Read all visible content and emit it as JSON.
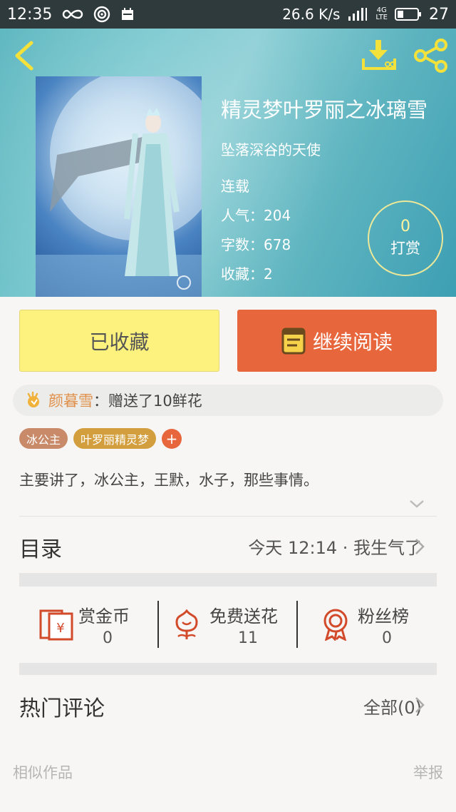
{
  "status_bar": {
    "time": "12:35",
    "speed": "26.6 K/s",
    "battery": "27"
  },
  "book": {
    "title": "精灵梦叶罗丽之冰璃雪",
    "author": "坠落深谷的天使",
    "status": "连载",
    "popularity_label": "人气：",
    "popularity": "204",
    "words_label": "字数：",
    "words": "678",
    "favorites_label": "收藏：",
    "favorites": "2"
  },
  "reward": {
    "count": "0",
    "label": "打赏"
  },
  "actions": {
    "favorited_label": "已收藏",
    "continue_label": "继续阅读"
  },
  "gift": {
    "user": "颜暮雪",
    "message": "：赠送了10鲜花"
  },
  "tags": [
    {
      "label": "冰公主",
      "color": "#c98a6a"
    },
    {
      "label": "叶罗丽精灵梦",
      "color": "#d39f3e"
    }
  ],
  "tag_add": "+",
  "description": "主要讲了，冰公主，王默，水子，那些事情。",
  "toc": {
    "title": "目录",
    "latest": "今天 12:14 · 我生气了"
  },
  "stats": [
    {
      "label": "赏金币",
      "value": "0",
      "icon": "red-envelope-icon"
    },
    {
      "label": "免费送花",
      "value": "11",
      "icon": "flower-icon"
    },
    {
      "label": "粉丝榜",
      "value": "0",
      "icon": "award-ribbon-icon"
    }
  ],
  "comments": {
    "title": "热门评论",
    "all_label": "全部(0)"
  },
  "footer": {
    "similar": "相似作品",
    "report": "举报"
  },
  "colors": {
    "accent_orange": "#e8663c",
    "favorite_yellow": "#fdf27d",
    "icon_red": "#d24a2a",
    "header_teal": "#6cc0c8"
  }
}
